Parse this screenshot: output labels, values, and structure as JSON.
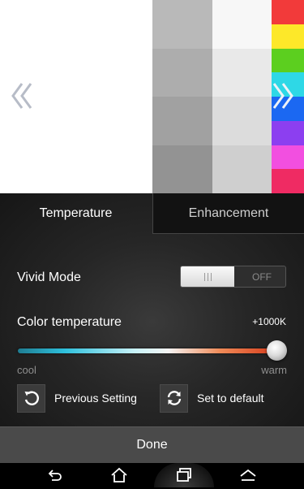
{
  "preview": {
    "gray_swatches": [
      "#b9b9b9",
      "#f7f7f7",
      "#adadad",
      "#e9e9e9",
      "#a1a1a1",
      "#dcdcdc",
      "#939393",
      "#cfcfcf"
    ],
    "color_strip": [
      "#f23a3a",
      "#fde829",
      "#5ccf1f",
      "#2ed8e6",
      "#1b68f2",
      "#8c3ff0",
      "#f24fe0",
      "#ef2b63"
    ],
    "prev_arrow_icon": "double-chevron-left-icon",
    "next_arrow_icon": "double-chevron-right-icon"
  },
  "tabs": [
    {
      "label": "Temperature",
      "selected": true
    },
    {
      "label": "Enhancement",
      "selected": false
    }
  ],
  "vivid_mode": {
    "label": "Vivid Mode",
    "toggle_off_label": "OFF",
    "state": "off"
  },
  "color_temperature": {
    "label": "Color temperature",
    "value_text": "+1000K",
    "min_label": "cool",
    "max_label": "warm",
    "slider_fraction": 1.0
  },
  "actions": {
    "previous": {
      "label": "Previous Setting",
      "icon": "undo-icon"
    },
    "default": {
      "label": "Set to default",
      "icon": "refresh-icon"
    }
  },
  "done_label": "Done",
  "navbar": {
    "icons": [
      "back-icon",
      "home-icon",
      "recent-apps-icon",
      "menu-icon"
    ]
  }
}
